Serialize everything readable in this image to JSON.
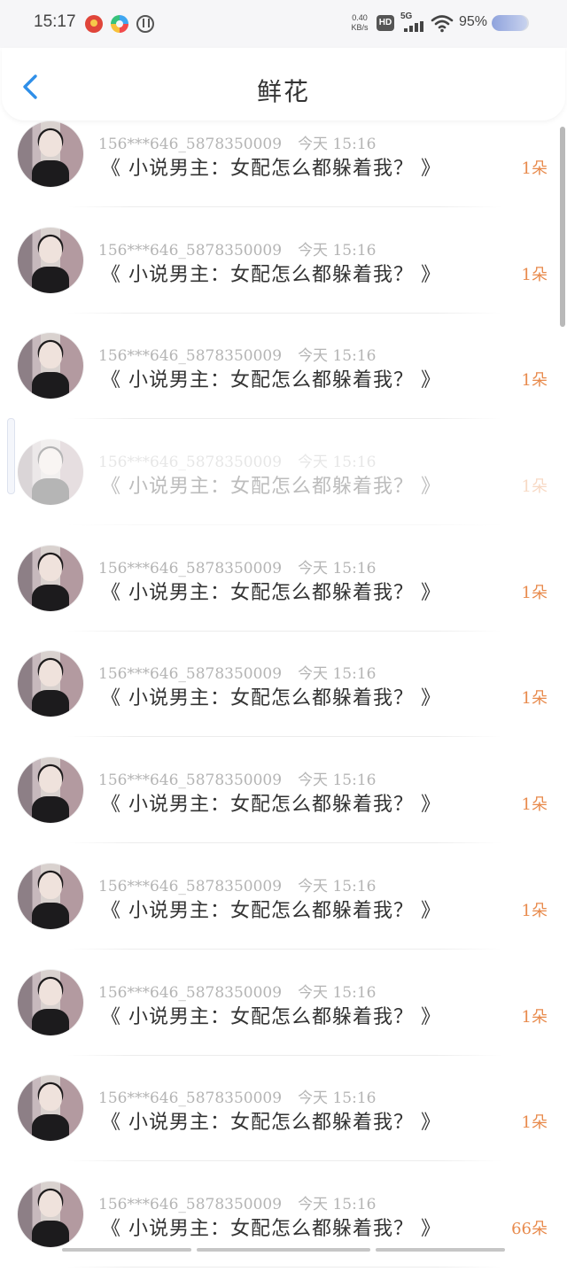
{
  "status_bar": {
    "time": "15:17",
    "net_speed_value": "0.40",
    "net_speed_unit": "KB/s",
    "hd_label": "HD",
    "network_label": "5G",
    "battery_text": "95%",
    "battery_level": 0.95
  },
  "header": {
    "title": "鲜花",
    "back_icon": "chevron-left-icon",
    "accent_color": "#2f8fe8"
  },
  "list": {
    "items": [
      {
        "user": "156***646_5878350009",
        "time": "今天 15:16",
        "book": "《 小说男主：女配怎么都躲着我？ 》",
        "count": "1朵"
      },
      {
        "user": "156***646_5878350009",
        "time": "今天 15:16",
        "book": "《 小说男主：女配怎么都躲着我？ 》",
        "count": "1朵"
      },
      {
        "user": "156***646_5878350009",
        "time": "今天 15:16",
        "book": "《 小说男主：女配怎么都躲着我？ 》",
        "count": "1朵"
      },
      {
        "user": "156***646_5878350009",
        "time": "今天 15:16",
        "book": "《 小说男主：女配怎么都躲着我？ 》",
        "count": "1朵"
      },
      {
        "user": "156***646_5878350009",
        "time": "今天 15:16",
        "book": "《 小说男主：女配怎么都躲着我？ 》",
        "count": "1朵"
      },
      {
        "user": "156***646_5878350009",
        "time": "今天 15:16",
        "book": "《 小说男主：女配怎么都躲着我？ 》",
        "count": "1朵"
      },
      {
        "user": "156***646_5878350009",
        "time": "今天 15:16",
        "book": "《 小说男主：女配怎么都躲着我？ 》",
        "count": "1朵"
      },
      {
        "user": "156***646_5878350009",
        "time": "今天 15:16",
        "book": "《 小说男主：女配怎么都躲着我？ 》",
        "count": "1朵"
      },
      {
        "user": "156***646_5878350009",
        "time": "今天 15:16",
        "book": "《 小说男主：女配怎么都躲着我？ 》",
        "count": "1朵"
      },
      {
        "user": "156***646_5878350009",
        "time": "今天 15:16",
        "book": "《 小说男主：女配怎么都躲着我？ 》",
        "count": "1朵"
      },
      {
        "user": "156***646_5878350009",
        "time": "今天 15:16",
        "book": "《 小说男主：女配怎么都躲着我？ 》",
        "count": "66朵"
      }
    ]
  },
  "colors": {
    "count_color": "#e88a4c",
    "meta_color": "#b4b4b4"
  }
}
